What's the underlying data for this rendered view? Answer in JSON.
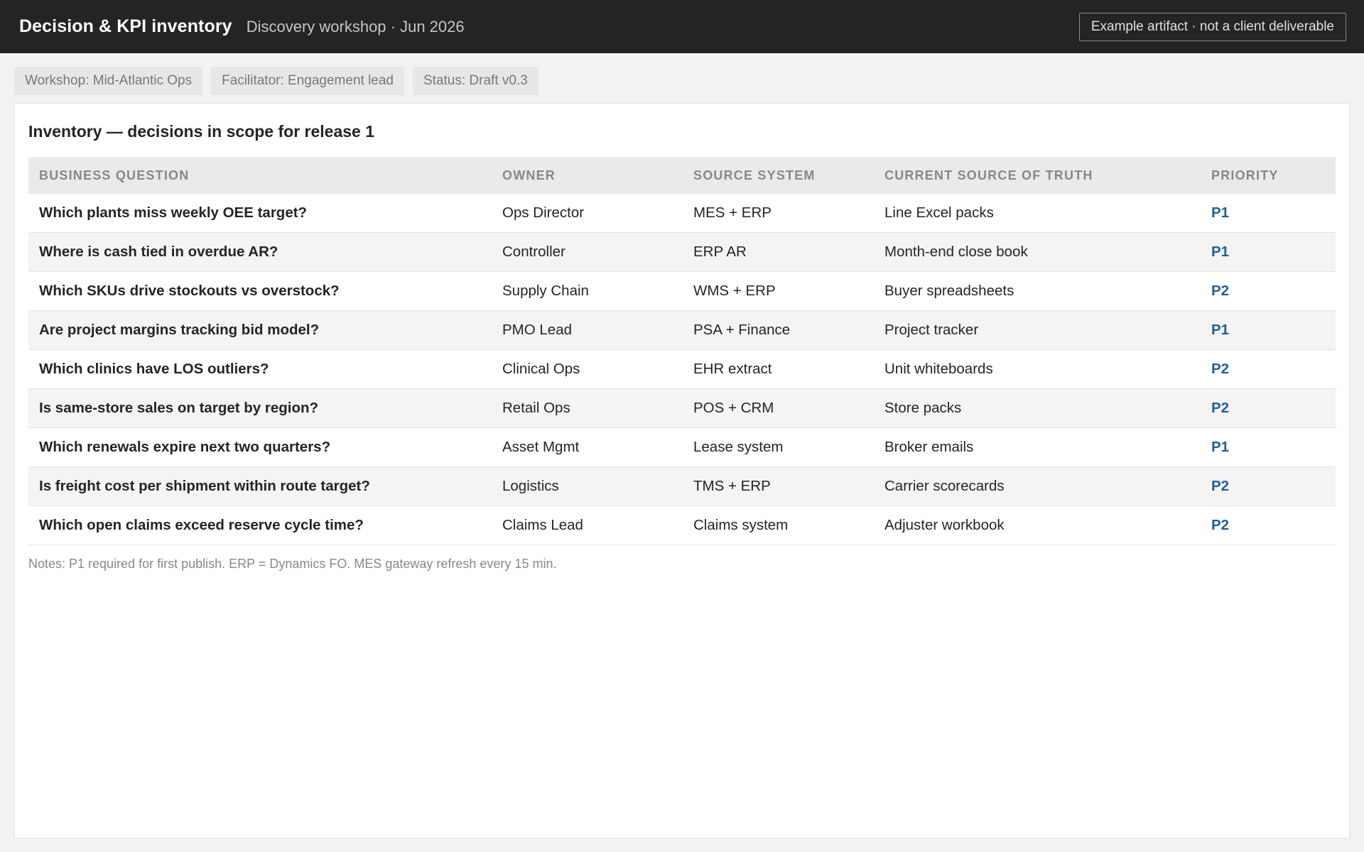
{
  "header": {
    "title": "Decision & KPI inventory",
    "subtitle": "Discovery workshop · Jun 2026",
    "disclaimer": "Example artifact · not a client deliverable"
  },
  "meta": {
    "chips": [
      "Workshop: Mid-Atlantic Ops",
      "Facilitator: Engagement lead",
      "Status: Draft v0.3"
    ]
  },
  "inventory": {
    "title": "Inventory — decisions in scope for release 1",
    "columns": [
      "Business question",
      "Owner",
      "Source system",
      "Current source of truth",
      "Priority"
    ],
    "rows": [
      {
        "question": "Which plants miss weekly OEE target?",
        "owner": "Ops Director",
        "source": "MES + ERP",
        "truth": "Line Excel packs",
        "priority": "P1"
      },
      {
        "question": "Where is cash tied in overdue AR?",
        "owner": "Controller",
        "source": "ERP AR",
        "truth": "Month-end close book",
        "priority": "P1"
      },
      {
        "question": "Which SKUs drive stockouts vs overstock?",
        "owner": "Supply Chain",
        "source": "WMS + ERP",
        "truth": "Buyer spreadsheets",
        "priority": "P2"
      },
      {
        "question": "Are project margins tracking bid model?",
        "owner": "PMO Lead",
        "source": "PSA + Finance",
        "truth": "Project tracker",
        "priority": "P1"
      },
      {
        "question": "Which clinics have LOS outliers?",
        "owner": "Clinical Ops",
        "source": "EHR extract",
        "truth": "Unit whiteboards",
        "priority": "P2"
      },
      {
        "question": "Is same-store sales on target by region?",
        "owner": "Retail Ops",
        "source": "POS + CRM",
        "truth": "Store packs",
        "priority": "P2"
      },
      {
        "question": "Which renewals expire next two quarters?",
        "owner": "Asset Mgmt",
        "source": "Lease system",
        "truth": "Broker emails",
        "priority": "P1"
      },
      {
        "question": "Is freight cost per shipment within route target?",
        "owner": "Logistics",
        "source": "TMS + ERP",
        "truth": "Carrier scorecards",
        "priority": "P2"
      },
      {
        "question": "Which open claims exceed reserve cycle time?",
        "owner": "Claims Lead",
        "source": "Claims system",
        "truth": "Adjuster workbook",
        "priority": "P2"
      }
    ],
    "notes": "Notes: P1 required for first publish. ERP = Dynamics FO. MES gateway refresh every 15 min."
  }
}
